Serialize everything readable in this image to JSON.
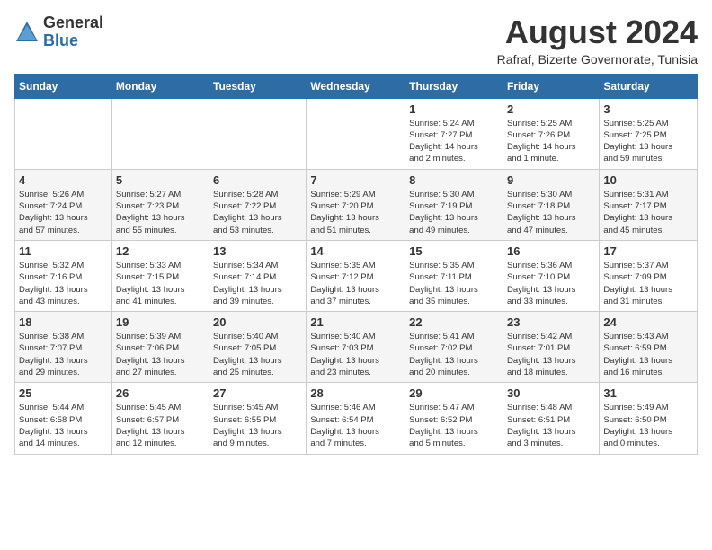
{
  "logo": {
    "general": "General",
    "blue": "Blue"
  },
  "title": "August 2024",
  "location": "Rafraf, Bizerte Governorate, Tunisia",
  "days_of_week": [
    "Sunday",
    "Monday",
    "Tuesday",
    "Wednesday",
    "Thursday",
    "Friday",
    "Saturday"
  ],
  "weeks": [
    [
      {
        "day": "",
        "info": ""
      },
      {
        "day": "",
        "info": ""
      },
      {
        "day": "",
        "info": ""
      },
      {
        "day": "",
        "info": ""
      },
      {
        "day": "1",
        "info": "Sunrise: 5:24 AM\nSunset: 7:27 PM\nDaylight: 14 hours\nand 2 minutes."
      },
      {
        "day": "2",
        "info": "Sunrise: 5:25 AM\nSunset: 7:26 PM\nDaylight: 14 hours\nand 1 minute."
      },
      {
        "day": "3",
        "info": "Sunrise: 5:25 AM\nSunset: 7:25 PM\nDaylight: 13 hours\nand 59 minutes."
      }
    ],
    [
      {
        "day": "4",
        "info": "Sunrise: 5:26 AM\nSunset: 7:24 PM\nDaylight: 13 hours\nand 57 minutes."
      },
      {
        "day": "5",
        "info": "Sunrise: 5:27 AM\nSunset: 7:23 PM\nDaylight: 13 hours\nand 55 minutes."
      },
      {
        "day": "6",
        "info": "Sunrise: 5:28 AM\nSunset: 7:22 PM\nDaylight: 13 hours\nand 53 minutes."
      },
      {
        "day": "7",
        "info": "Sunrise: 5:29 AM\nSunset: 7:20 PM\nDaylight: 13 hours\nand 51 minutes."
      },
      {
        "day": "8",
        "info": "Sunrise: 5:30 AM\nSunset: 7:19 PM\nDaylight: 13 hours\nand 49 minutes."
      },
      {
        "day": "9",
        "info": "Sunrise: 5:30 AM\nSunset: 7:18 PM\nDaylight: 13 hours\nand 47 minutes."
      },
      {
        "day": "10",
        "info": "Sunrise: 5:31 AM\nSunset: 7:17 PM\nDaylight: 13 hours\nand 45 minutes."
      }
    ],
    [
      {
        "day": "11",
        "info": "Sunrise: 5:32 AM\nSunset: 7:16 PM\nDaylight: 13 hours\nand 43 minutes."
      },
      {
        "day": "12",
        "info": "Sunrise: 5:33 AM\nSunset: 7:15 PM\nDaylight: 13 hours\nand 41 minutes."
      },
      {
        "day": "13",
        "info": "Sunrise: 5:34 AM\nSunset: 7:14 PM\nDaylight: 13 hours\nand 39 minutes."
      },
      {
        "day": "14",
        "info": "Sunrise: 5:35 AM\nSunset: 7:12 PM\nDaylight: 13 hours\nand 37 minutes."
      },
      {
        "day": "15",
        "info": "Sunrise: 5:35 AM\nSunset: 7:11 PM\nDaylight: 13 hours\nand 35 minutes."
      },
      {
        "day": "16",
        "info": "Sunrise: 5:36 AM\nSunset: 7:10 PM\nDaylight: 13 hours\nand 33 minutes."
      },
      {
        "day": "17",
        "info": "Sunrise: 5:37 AM\nSunset: 7:09 PM\nDaylight: 13 hours\nand 31 minutes."
      }
    ],
    [
      {
        "day": "18",
        "info": "Sunrise: 5:38 AM\nSunset: 7:07 PM\nDaylight: 13 hours\nand 29 minutes."
      },
      {
        "day": "19",
        "info": "Sunrise: 5:39 AM\nSunset: 7:06 PM\nDaylight: 13 hours\nand 27 minutes."
      },
      {
        "day": "20",
        "info": "Sunrise: 5:40 AM\nSunset: 7:05 PM\nDaylight: 13 hours\nand 25 minutes."
      },
      {
        "day": "21",
        "info": "Sunrise: 5:40 AM\nSunset: 7:03 PM\nDaylight: 13 hours\nand 23 minutes."
      },
      {
        "day": "22",
        "info": "Sunrise: 5:41 AM\nSunset: 7:02 PM\nDaylight: 13 hours\nand 20 minutes."
      },
      {
        "day": "23",
        "info": "Sunrise: 5:42 AM\nSunset: 7:01 PM\nDaylight: 13 hours\nand 18 minutes."
      },
      {
        "day": "24",
        "info": "Sunrise: 5:43 AM\nSunset: 6:59 PM\nDaylight: 13 hours\nand 16 minutes."
      }
    ],
    [
      {
        "day": "25",
        "info": "Sunrise: 5:44 AM\nSunset: 6:58 PM\nDaylight: 13 hours\nand 14 minutes."
      },
      {
        "day": "26",
        "info": "Sunrise: 5:45 AM\nSunset: 6:57 PM\nDaylight: 13 hours\nand 12 minutes."
      },
      {
        "day": "27",
        "info": "Sunrise: 5:45 AM\nSunset: 6:55 PM\nDaylight: 13 hours\nand 9 minutes."
      },
      {
        "day": "28",
        "info": "Sunrise: 5:46 AM\nSunset: 6:54 PM\nDaylight: 13 hours\nand 7 minutes."
      },
      {
        "day": "29",
        "info": "Sunrise: 5:47 AM\nSunset: 6:52 PM\nDaylight: 13 hours\nand 5 minutes."
      },
      {
        "day": "30",
        "info": "Sunrise: 5:48 AM\nSunset: 6:51 PM\nDaylight: 13 hours\nand 3 minutes."
      },
      {
        "day": "31",
        "info": "Sunrise: 5:49 AM\nSunset: 6:50 PM\nDaylight: 13 hours\nand 0 minutes."
      }
    ]
  ]
}
